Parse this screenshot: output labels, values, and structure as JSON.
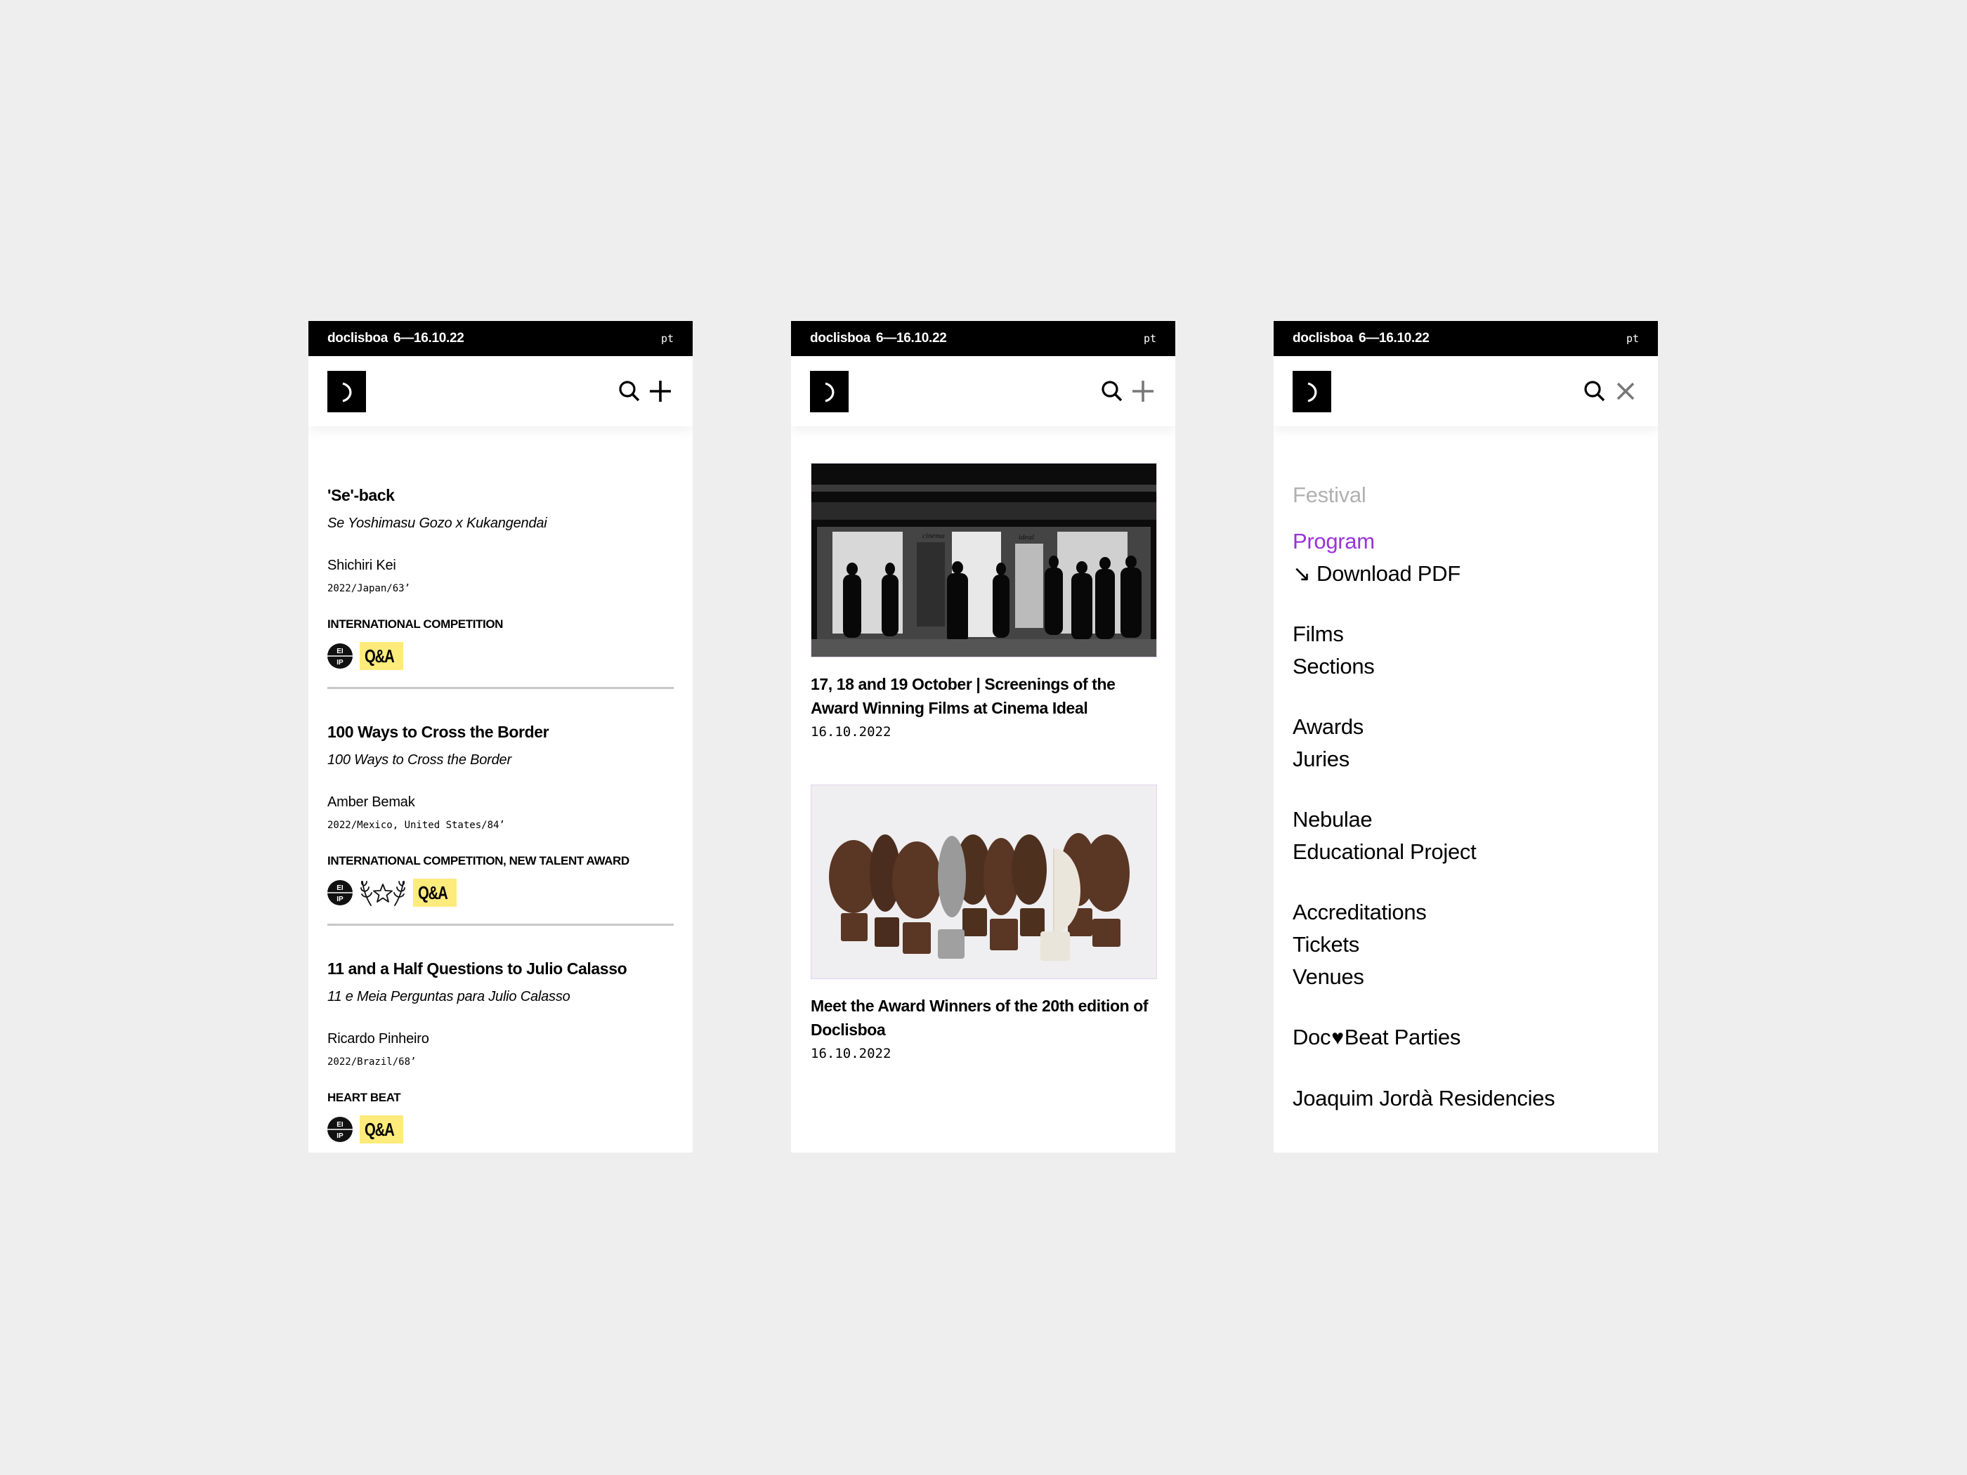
{
  "header": {
    "brand": "doclisboa",
    "dates": "6—16.10.22",
    "language": "pt",
    "logo_icon": "crescent-logo-icon",
    "search_icon": "search-icon",
    "open_menu_icon": "plus-icon",
    "close_menu_icon": "close-icon"
  },
  "program": {
    "films": [
      {
        "title": "'Se'-back",
        "original_title": "Se Yoshimasu Gozo x Kukangendai",
        "director": "Shichiri Kei",
        "meta": "2022/Japan/63’",
        "sections": "INTERNATIONAL COMPETITION",
        "badges": [
          "EI IP",
          "Q&A"
        ]
      },
      {
        "title": "100 Ways to Cross the Border",
        "original_title": "100 Ways to Cross the Border",
        "director": "Amber Bemak",
        "meta": "2022/Mexico, United States/84’",
        "sections": "INTERNATIONAL COMPETITION, NEW TALENT AWARD",
        "badges": [
          "EI IP",
          "award-laurel",
          "Q&A"
        ]
      },
      {
        "title": "11 and a Half Questions to Julio Calasso",
        "original_title": "11 e Meia Perguntas para Julio Calasso",
        "director": "Ricardo Pinheiro",
        "meta": "2022/Brazil/68’",
        "sections": "HEART BEAT",
        "badges": [
          "EI IP",
          "Q&A"
        ]
      }
    ],
    "badge_labels": {
      "eiip_top": "EI",
      "eiip_bottom": "IP",
      "qa": "Q&A"
    }
  },
  "news": {
    "items": [
      {
        "image": "Black-and-white photo of people standing outside Cinema Ideal at night",
        "image_sign_left": "cinema",
        "image_sign_right": "ideal",
        "title": "17, 18 and 19 October | Screenings of the Award Winning Films at Cinema Ideal",
        "date": "16.10.2022"
      },
      {
        "image": "Wooden and stone award trophies on white background",
        "title": "Meet the Award Winners of the 20th edition of Doclisboa",
        "date": "16.10.2022"
      }
    ]
  },
  "menu": {
    "header": "Festival",
    "groups": [
      {
        "items": [
          "Program",
          "↘ Download PDF"
        ]
      },
      {
        "items": [
          "Films",
          "Sections"
        ]
      },
      {
        "items": [
          "Awards",
          "Juries"
        ]
      },
      {
        "items": [
          "Nebulae",
          "Educational Project"
        ]
      },
      {
        "items": [
          "Accreditations",
          "Tickets",
          "Venues"
        ]
      },
      {
        "items": [
          "Doc",
          "Beat Parties"
        ]
      },
      {
        "items": [
          "Joaquim Jordà Residencies"
        ]
      }
    ],
    "active_item": "Program",
    "colors": {
      "active": "#9a33d6",
      "muted": "#b1b1b1"
    }
  },
  "colors": {
    "background": "#eeeeee",
    "topbar": "#000000",
    "qa_badge": "#fdeb7c",
    "divider": "#c8c8c8"
  }
}
